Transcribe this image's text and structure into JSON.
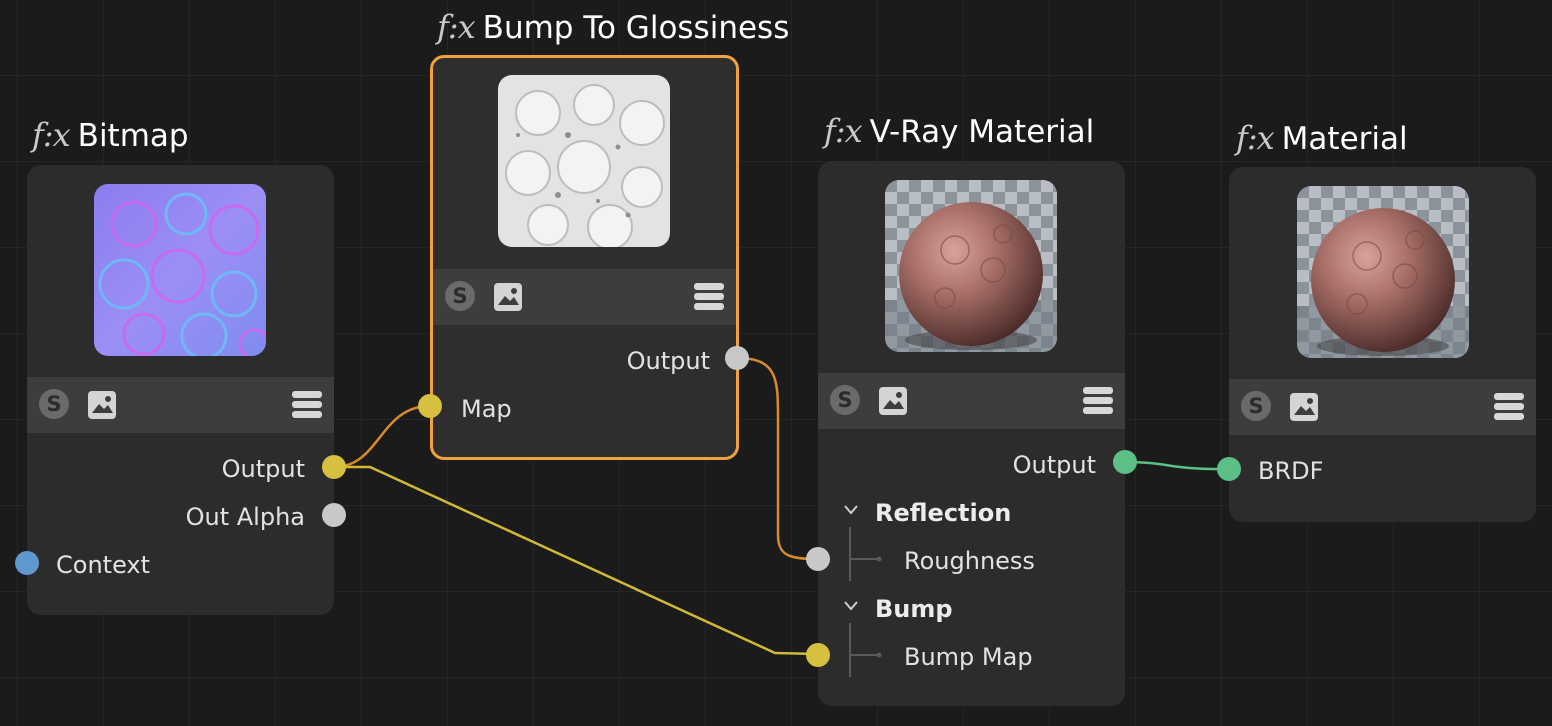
{
  "nodes": {
    "bitmap": {
      "title": "Bitmap",
      "fx": "f:x",
      "toolbar": {
        "s_label": "S",
        "icons": [
          "image-icon",
          "menu-icon"
        ]
      },
      "ports": {
        "output": "Output",
        "out_alpha": "Out Alpha",
        "context": "Context"
      }
    },
    "bump_to_glossiness": {
      "title": "Bump To Glossiness",
      "fx": "f:x",
      "selected": true,
      "toolbar": {
        "s_label": "S",
        "icons": [
          "image-icon",
          "menu-icon"
        ]
      },
      "ports": {
        "output": "Output",
        "map": "Map"
      }
    },
    "vray_material": {
      "title": "V-Ray Material",
      "fx": "f:x",
      "toolbar": {
        "s_label": "S",
        "icons": [
          "image-icon",
          "menu-icon"
        ]
      },
      "ports": {
        "output": "Output"
      },
      "groups": [
        {
          "label": "Reflection",
          "items": [
            "Roughness"
          ]
        },
        {
          "label": "Bump",
          "items": [
            "Bump Map"
          ]
        }
      ]
    },
    "material": {
      "title": "Material",
      "fx": "f:x",
      "toolbar": {
        "s_label": "S",
        "icons": [
          "image-icon",
          "menu-icon"
        ]
      },
      "ports": {
        "brdf": "BRDF"
      }
    }
  },
  "colors": {
    "background": "#1b1b1b",
    "node": "#2c2c2c",
    "selected_border": "#f0a23c",
    "port_yellow": "#d7bf3f",
    "port_grey": "#c8c8c8",
    "port_blue": "#5f98cf",
    "port_green": "#5cbf86",
    "wire_orange": "#d88a2a",
    "wire_yellow": "#d2b934",
    "wire_green": "#5cbf86"
  }
}
